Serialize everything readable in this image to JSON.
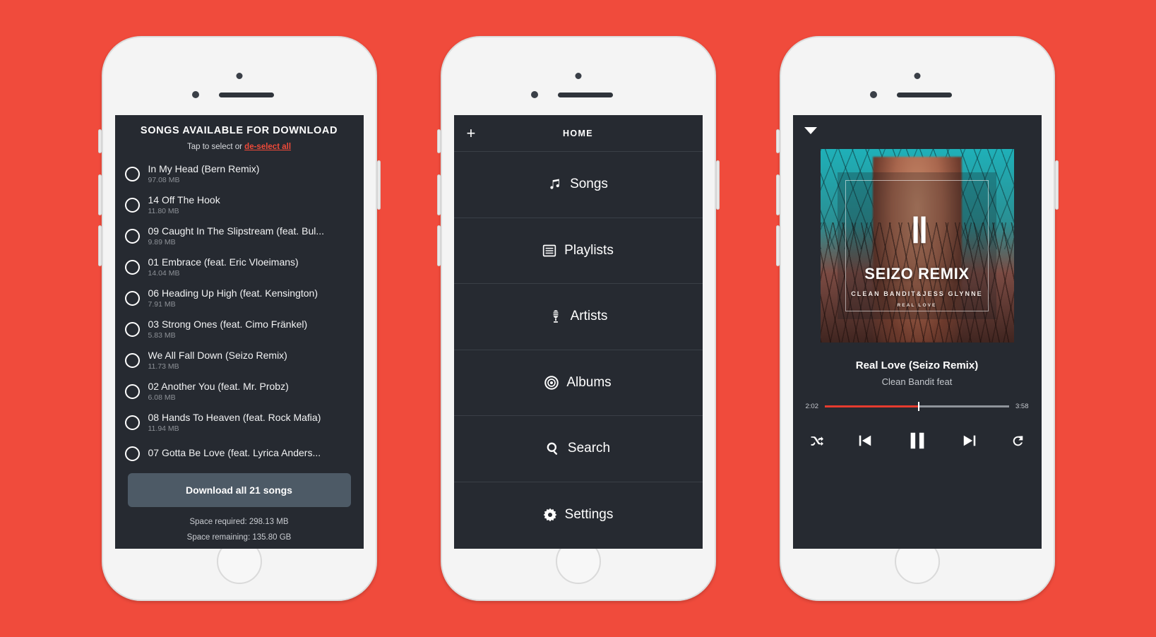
{
  "phone_download": {
    "title": "SONGS AVAILABLE FOR DOWNLOAD",
    "subtitle_prefix": "Tap to select or ",
    "subtitle_link": "de-select all",
    "songs": [
      {
        "name": "In My Head (Bern Remix)",
        "size": "97.08 MB"
      },
      {
        "name": "14 Off The Hook",
        "size": "11.80 MB"
      },
      {
        "name": "09 Caught In The Slipstream (feat. Bul...",
        "size": "9.89 MB"
      },
      {
        "name": "01 Embrace (feat. Eric Vloeimans)",
        "size": "14.04 MB"
      },
      {
        "name": "06 Heading Up High (feat. Kensington)",
        "size": "7.91 MB"
      },
      {
        "name": "03 Strong Ones (feat. Cimo Fränkel)",
        "size": "5.83 MB"
      },
      {
        "name": "We All Fall Down (Seizo Remix)",
        "size": "11.73 MB"
      },
      {
        "name": "02 Another You (feat. Mr. Probz)",
        "size": "6.08 MB"
      },
      {
        "name": "08 Hands To Heaven (feat. Rock Mafia)",
        "size": "11.94 MB"
      },
      {
        "name": "07 Gotta Be Love (feat. Lyrica Anders...",
        "size": ""
      }
    ],
    "download_button": "Download all 21 songs",
    "space_required": "Space required: 298.13 MB",
    "space_remaining": "Space remaining: 135.80 GB"
  },
  "phone_home": {
    "header_title": "HOME",
    "add_label": "+",
    "items": [
      {
        "label": "Songs",
        "icon": "music-note-icon"
      },
      {
        "label": "Playlists",
        "icon": "list-icon"
      },
      {
        "label": "Artists",
        "icon": "microphone-icon"
      },
      {
        "label": "Albums",
        "icon": "record-icon"
      },
      {
        "label": "Search",
        "icon": "search-icon"
      },
      {
        "label": "Settings",
        "icon": "gear-icon"
      }
    ]
  },
  "phone_player": {
    "collapse_icon": "caret-down-icon",
    "artwork": {
      "logo_text": "‖",
      "main_text": "SEIZO REMIX",
      "sub_text": "CLEAN BANDIT&JESS GLYNNE",
      "sub_text2": "REAL LOVE"
    },
    "track_title": "Real Love (Seizo Remix)",
    "track_artist": "Clean Bandit feat",
    "elapsed": "2:02",
    "duration": "3:58",
    "progress_percent": 51,
    "controls": [
      {
        "name": "shuffle",
        "icon": "shuffle-icon"
      },
      {
        "name": "previous",
        "icon": "previous-track-icon"
      },
      {
        "name": "pause",
        "icon": "pause-icon"
      },
      {
        "name": "next",
        "icon": "next-track-icon"
      },
      {
        "name": "repeat",
        "icon": "repeat-icon"
      }
    ]
  },
  "colors": {
    "background": "#f04b3c",
    "screen": "#262a31",
    "accent_red": "#ef4a39",
    "button_slate": "#4d5a66"
  }
}
